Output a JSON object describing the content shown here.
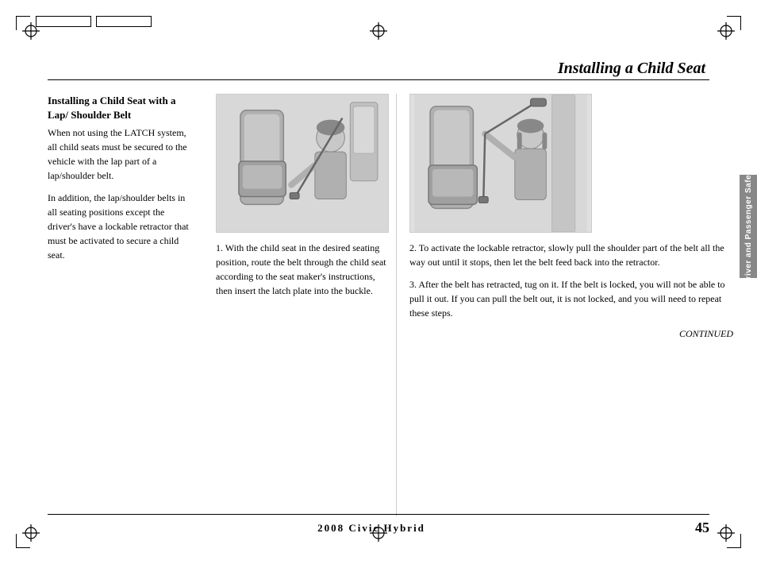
{
  "page": {
    "title": "Installing a Child Seat",
    "footer_left": "",
    "footer_center": "2008  Civic  Hybrid",
    "footer_page": "45",
    "sidebar_tab": "Driver and Passenger Safety"
  },
  "left_column": {
    "section_title": "Installing a Child Seat with a Lap/\nShoulder Belt",
    "paragraph1": "When not using the LATCH system, all child seats must be secured to the vehicle with the lap part of a lap/shoulder belt.",
    "paragraph2": "In addition, the lap/shoulder belts in all seating positions except the driver's have a lockable retractor that must be activated to secure a child seat."
  },
  "steps": {
    "step1": "1. With the child seat in the desired seating position, route the belt through the child seat according to the seat maker's instructions, then insert the latch plate into the buckle.",
    "step2": "2. To activate the lockable retractor, slowly pull the shoulder part of the belt all the way out until it stops, then let the belt feed back into the retractor.",
    "step3": "3. After the belt has retracted, tug on it. If the belt is locked, you will not be able to pull it out. If you can pull the belt out, it is not locked, and you will need to repeat these steps.",
    "continued": "CONTINUED"
  }
}
